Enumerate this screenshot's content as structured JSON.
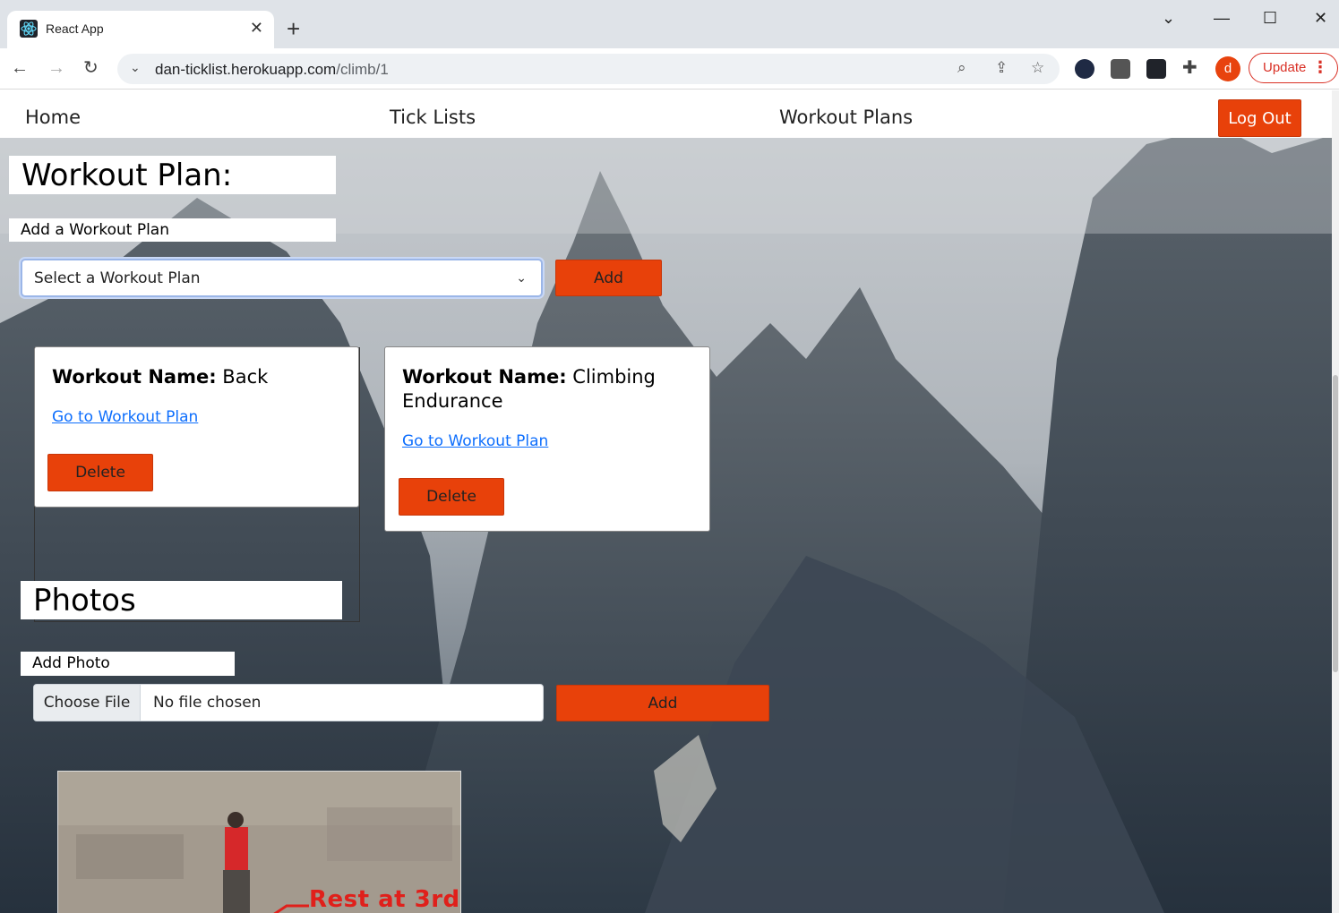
{
  "browser": {
    "tab_title": "React App",
    "url_host": "dan-ticklist.herokuapp.com",
    "url_path": "/climb/1",
    "profile_initial": "d",
    "update_label": "Update"
  },
  "nav": {
    "home": "Home",
    "tick_lists": "Tick Lists",
    "workout_plans": "Workout Plans",
    "logout": "Log Out"
  },
  "workout": {
    "heading": "Workout Plan:",
    "add_heading": "Add a Workout Plan",
    "select_value": "Select a Workout Plan",
    "add_button": "Add",
    "name_label": "Workout Name:",
    "link_label": "Go to Workout Plan",
    "delete_label": "Delete",
    "plans": [
      {
        "name": "Back"
      },
      {
        "name": "Climbing Endurance"
      }
    ]
  },
  "photos": {
    "heading": "Photos",
    "add_heading": "Add Photo",
    "choose_file": "Choose File",
    "file_status": "No file chosen",
    "add_button": "Add",
    "photo_caption": "Rest at 3rd"
  },
  "colors": {
    "accent": "#e8410a",
    "link": "#0d6efd"
  }
}
